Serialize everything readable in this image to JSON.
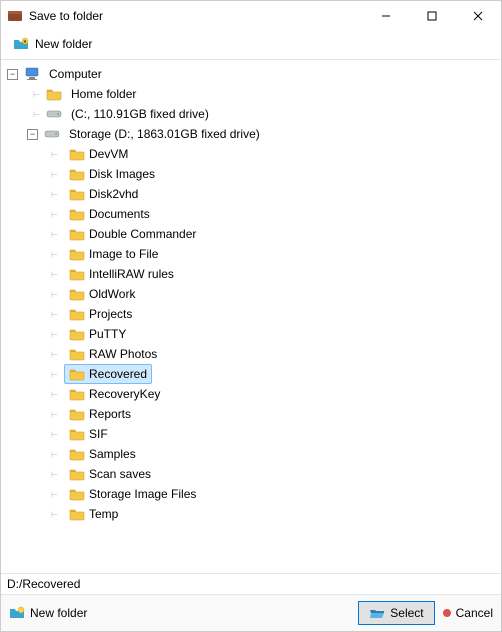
{
  "window": {
    "title": "Save to folder"
  },
  "toolbar": {
    "new_folder": "New folder"
  },
  "tree": {
    "root": {
      "label": "Computer",
      "expanded": true
    },
    "home_folder": "Home folder",
    "drive_c": "(C:, 110.91GB fixed drive)",
    "storage_node": {
      "label": "Storage (D:, 1863.01GB fixed drive)",
      "expanded": true
    },
    "folders": [
      "DevVM",
      "Disk Images",
      "Disk2vhd",
      "Documents",
      "Double Commander",
      "Image to File",
      "IntelliRAW rules",
      "OldWork",
      "Projects",
      "PuTTY",
      "RAW Photos",
      "Recovered",
      "RecoveryKey",
      "Reports",
      "SIF",
      "Samples",
      "Scan saves",
      "Storage Image Files",
      "Temp"
    ],
    "selected": "Recovered"
  },
  "path": "D:/Recovered",
  "bottom": {
    "new_folder": "New folder",
    "select": "Select",
    "cancel": "Cancel"
  }
}
